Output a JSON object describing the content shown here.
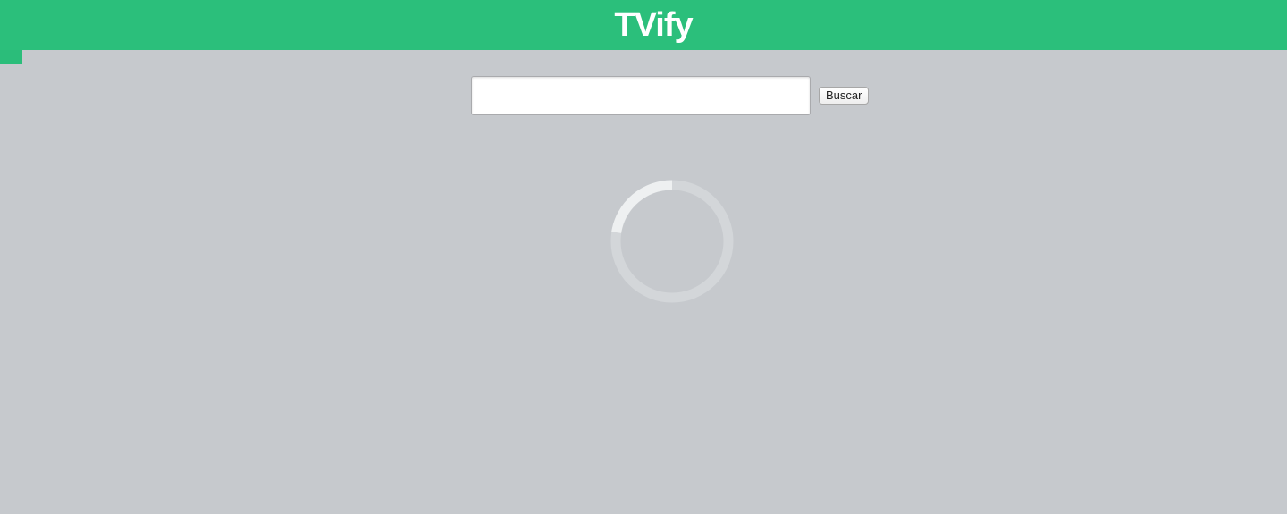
{
  "header": {
    "title": "TVify",
    "color": "#2bbf7b"
  },
  "search": {
    "value": "",
    "placeholder": "",
    "button_label": "Buscar"
  },
  "loader": {
    "icon": "loading-spinner-icon",
    "track_color": "#d3d6d9",
    "arc_color": "#eef0f1"
  },
  "colors": {
    "background": "#c6c9cd",
    "accent": "#2bbf7b"
  }
}
